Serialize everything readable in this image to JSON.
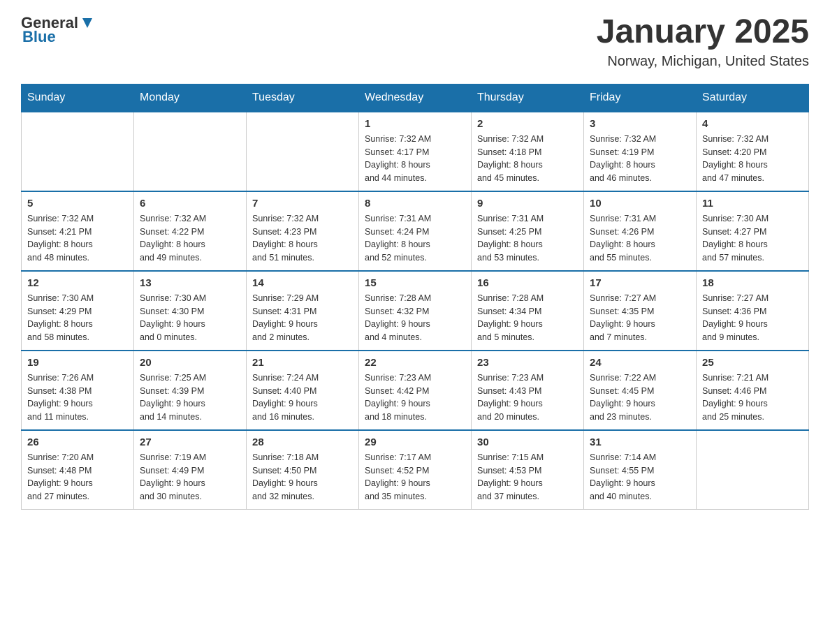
{
  "header": {
    "logo_general": "General",
    "logo_blue": "Blue",
    "title": "January 2025",
    "subtitle": "Norway, Michigan, United States"
  },
  "days_of_week": [
    "Sunday",
    "Monday",
    "Tuesday",
    "Wednesday",
    "Thursday",
    "Friday",
    "Saturday"
  ],
  "weeks": [
    {
      "days": [
        {
          "date": "",
          "info": ""
        },
        {
          "date": "",
          "info": ""
        },
        {
          "date": "",
          "info": ""
        },
        {
          "date": "1",
          "info": "Sunrise: 7:32 AM\nSunset: 4:17 PM\nDaylight: 8 hours\nand 44 minutes."
        },
        {
          "date": "2",
          "info": "Sunrise: 7:32 AM\nSunset: 4:18 PM\nDaylight: 8 hours\nand 45 minutes."
        },
        {
          "date": "3",
          "info": "Sunrise: 7:32 AM\nSunset: 4:19 PM\nDaylight: 8 hours\nand 46 minutes."
        },
        {
          "date": "4",
          "info": "Sunrise: 7:32 AM\nSunset: 4:20 PM\nDaylight: 8 hours\nand 47 minutes."
        }
      ]
    },
    {
      "days": [
        {
          "date": "5",
          "info": "Sunrise: 7:32 AM\nSunset: 4:21 PM\nDaylight: 8 hours\nand 48 minutes."
        },
        {
          "date": "6",
          "info": "Sunrise: 7:32 AM\nSunset: 4:22 PM\nDaylight: 8 hours\nand 49 minutes."
        },
        {
          "date": "7",
          "info": "Sunrise: 7:32 AM\nSunset: 4:23 PM\nDaylight: 8 hours\nand 51 minutes."
        },
        {
          "date": "8",
          "info": "Sunrise: 7:31 AM\nSunset: 4:24 PM\nDaylight: 8 hours\nand 52 minutes."
        },
        {
          "date": "9",
          "info": "Sunrise: 7:31 AM\nSunset: 4:25 PM\nDaylight: 8 hours\nand 53 minutes."
        },
        {
          "date": "10",
          "info": "Sunrise: 7:31 AM\nSunset: 4:26 PM\nDaylight: 8 hours\nand 55 minutes."
        },
        {
          "date": "11",
          "info": "Sunrise: 7:30 AM\nSunset: 4:27 PM\nDaylight: 8 hours\nand 57 minutes."
        }
      ]
    },
    {
      "days": [
        {
          "date": "12",
          "info": "Sunrise: 7:30 AM\nSunset: 4:29 PM\nDaylight: 8 hours\nand 58 minutes."
        },
        {
          "date": "13",
          "info": "Sunrise: 7:30 AM\nSunset: 4:30 PM\nDaylight: 9 hours\nand 0 minutes."
        },
        {
          "date": "14",
          "info": "Sunrise: 7:29 AM\nSunset: 4:31 PM\nDaylight: 9 hours\nand 2 minutes."
        },
        {
          "date": "15",
          "info": "Sunrise: 7:28 AM\nSunset: 4:32 PM\nDaylight: 9 hours\nand 4 minutes."
        },
        {
          "date": "16",
          "info": "Sunrise: 7:28 AM\nSunset: 4:34 PM\nDaylight: 9 hours\nand 5 minutes."
        },
        {
          "date": "17",
          "info": "Sunrise: 7:27 AM\nSunset: 4:35 PM\nDaylight: 9 hours\nand 7 minutes."
        },
        {
          "date": "18",
          "info": "Sunrise: 7:27 AM\nSunset: 4:36 PM\nDaylight: 9 hours\nand 9 minutes."
        }
      ]
    },
    {
      "days": [
        {
          "date": "19",
          "info": "Sunrise: 7:26 AM\nSunset: 4:38 PM\nDaylight: 9 hours\nand 11 minutes."
        },
        {
          "date": "20",
          "info": "Sunrise: 7:25 AM\nSunset: 4:39 PM\nDaylight: 9 hours\nand 14 minutes."
        },
        {
          "date": "21",
          "info": "Sunrise: 7:24 AM\nSunset: 4:40 PM\nDaylight: 9 hours\nand 16 minutes."
        },
        {
          "date": "22",
          "info": "Sunrise: 7:23 AM\nSunset: 4:42 PM\nDaylight: 9 hours\nand 18 minutes."
        },
        {
          "date": "23",
          "info": "Sunrise: 7:23 AM\nSunset: 4:43 PM\nDaylight: 9 hours\nand 20 minutes."
        },
        {
          "date": "24",
          "info": "Sunrise: 7:22 AM\nSunset: 4:45 PM\nDaylight: 9 hours\nand 23 minutes."
        },
        {
          "date": "25",
          "info": "Sunrise: 7:21 AM\nSunset: 4:46 PM\nDaylight: 9 hours\nand 25 minutes."
        }
      ]
    },
    {
      "days": [
        {
          "date": "26",
          "info": "Sunrise: 7:20 AM\nSunset: 4:48 PM\nDaylight: 9 hours\nand 27 minutes."
        },
        {
          "date": "27",
          "info": "Sunrise: 7:19 AM\nSunset: 4:49 PM\nDaylight: 9 hours\nand 30 minutes."
        },
        {
          "date": "28",
          "info": "Sunrise: 7:18 AM\nSunset: 4:50 PM\nDaylight: 9 hours\nand 32 minutes."
        },
        {
          "date": "29",
          "info": "Sunrise: 7:17 AM\nSunset: 4:52 PM\nDaylight: 9 hours\nand 35 minutes."
        },
        {
          "date": "30",
          "info": "Sunrise: 7:15 AM\nSunset: 4:53 PM\nDaylight: 9 hours\nand 37 minutes."
        },
        {
          "date": "31",
          "info": "Sunrise: 7:14 AM\nSunset: 4:55 PM\nDaylight: 9 hours\nand 40 minutes."
        },
        {
          "date": "",
          "info": ""
        }
      ]
    }
  ]
}
